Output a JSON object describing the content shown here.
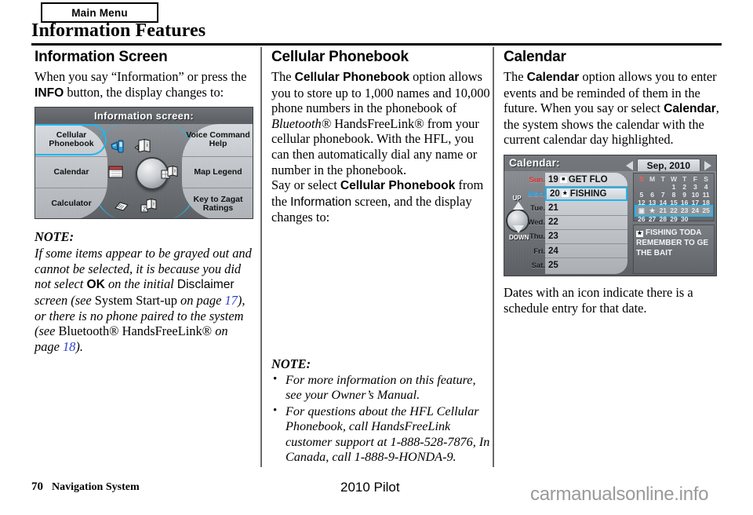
{
  "header": {
    "tab_label": "Main Menu",
    "page_title": "Information Features"
  },
  "left_column": {
    "heading": "Information Screen",
    "paragraph_1_a": "When you say “Information” or press the ",
    "paragraph_1_b": "INFO",
    "paragraph_1_c": " button, the display changes to:",
    "nav_screen": {
      "title": "Information screen:",
      "left_items": [
        "Cellular Phonebook",
        "Calendar",
        "Calculator"
      ],
      "right_items": [
        "Voice Command Help",
        "Map Legend",
        "Key to Zagat Ratings"
      ],
      "selected_item": "Cellular Phonebook",
      "icons": [
        "phone-headset-icon",
        "book-info-icon",
        "calendar-icon",
        "joystick-knob-icon",
        "map-legend-icon",
        "calculator-icon",
        "zagat-book-icon"
      ],
      "highlight_color": "#21b6f0"
    },
    "note_heading": "NOTE:",
    "note_1": "If some items appear to be grayed out and cannot be selected, it is because you did not select ",
    "note_ok": "OK",
    "note_2": " on the initial ",
    "note_disclaimer": "Disclaimer",
    "note_3": " screen (see ",
    "note_startup": "System Start-up",
    "note_4": " on page ",
    "note_page_17": "17",
    "note_5": "), or there is no phone paired to the system (see ",
    "note_bt": "Bluetooth® HandsFreeLink®",
    "note_6": " on page ",
    "note_page_18": "18",
    "note_7": ")."
  },
  "middle_column": {
    "heading": "Cellular Phonebook",
    "p1_a": "The ",
    "p1_b": "Cellular Phonebook",
    "p1_c": " option allows you to store up to 1,000 names and 10,000 phone numbers in the phonebook of ",
    "p1_bt": "Bluetooth®",
    "p1_d": " HandsFreeLink® from your cellular phonebook. With the HFL, you can then automatically dial any name or number in the phonebook.",
    "p2_a": "Say or select ",
    "p2_b": "Cellular Phonebook",
    "p2_c": " from the ",
    "p2_d": "Information",
    "p2_e": " screen, and the display changes to:",
    "note_heading": "NOTE:",
    "note_items": [
      "For more information on this feature, see your Owner’s Manual.",
      "For questions about the HFL Cellular Phonebook, call HandsFreeLink customer support at 1-888-528-7876, In Canada, call 1-888-9-HONDA-9."
    ]
  },
  "right_column": {
    "heading": "Calendar",
    "p1_a": "The ",
    "p1_b": "Calendar",
    "p1_c": " option allows you to enter events and be reminded of them in the future. When you say or select ",
    "p1_d": "Calendar",
    "p1_e": ", the system shows the calendar with the current calendar day highlighted.",
    "calendar_screen": {
      "title": "Calendar:",
      "month_label": "Sep, 2010",
      "prev_arrow": "left-arrow-icon",
      "next_arrow": "right-arrow-icon",
      "up_label": "UP",
      "down_label": "DOWN",
      "day_labels": [
        "Sun.",
        "Mon.",
        "Tue.",
        "Wed.",
        "Thu.",
        "Fri.",
        "Sat."
      ],
      "entries": [
        {
          "date": "19",
          "icon": "person-icon",
          "text": "GET FLO",
          "selected": false
        },
        {
          "date": "20",
          "icon": "star-icon",
          "text": "FISHING",
          "selected": true
        },
        {
          "date": "21",
          "icon": "",
          "text": "",
          "selected": false
        },
        {
          "date": "22",
          "icon": "",
          "text": "",
          "selected": false
        },
        {
          "date": "23",
          "icon": "",
          "text": "",
          "selected": false
        },
        {
          "date": "24",
          "icon": "",
          "text": "",
          "selected": false
        },
        {
          "date": "25",
          "icon": "",
          "text": "",
          "selected": false
        }
      ],
      "mini_calendar": {
        "weekday_headers": [
          "S",
          "M",
          "T",
          "W",
          "T",
          "F",
          "S"
        ],
        "weeks": [
          [
            "",
            "",
            "",
            "1",
            "2",
            "3",
            "4"
          ],
          [
            "5",
            "6",
            "7",
            "8",
            "9",
            "10",
            "11"
          ],
          [
            "12",
            "13",
            "14",
            "15",
            "16",
            "17",
            "18"
          ],
          [
            "▣",
            "★",
            "21",
            "22",
            "23",
            "24",
            "25"
          ],
          [
            "26",
            "27",
            "28",
            "29",
            "30",
            "",
            ""
          ]
        ],
        "highlight_row_index": 3
      },
      "event_detail": [
        "FISHING TODA",
        "REMEMBER TO GE",
        "THE BAIT"
      ],
      "event_detail_icon": "star-icon",
      "highlight_color": "#21b6f0"
    },
    "closing_text": "Dates with an icon indicate there is a schedule entry for that date."
  },
  "footer": {
    "page_number": "70",
    "section_label": "Navigation System",
    "model": "2010 Pilot",
    "watermark": "carmanualsonline.info"
  }
}
